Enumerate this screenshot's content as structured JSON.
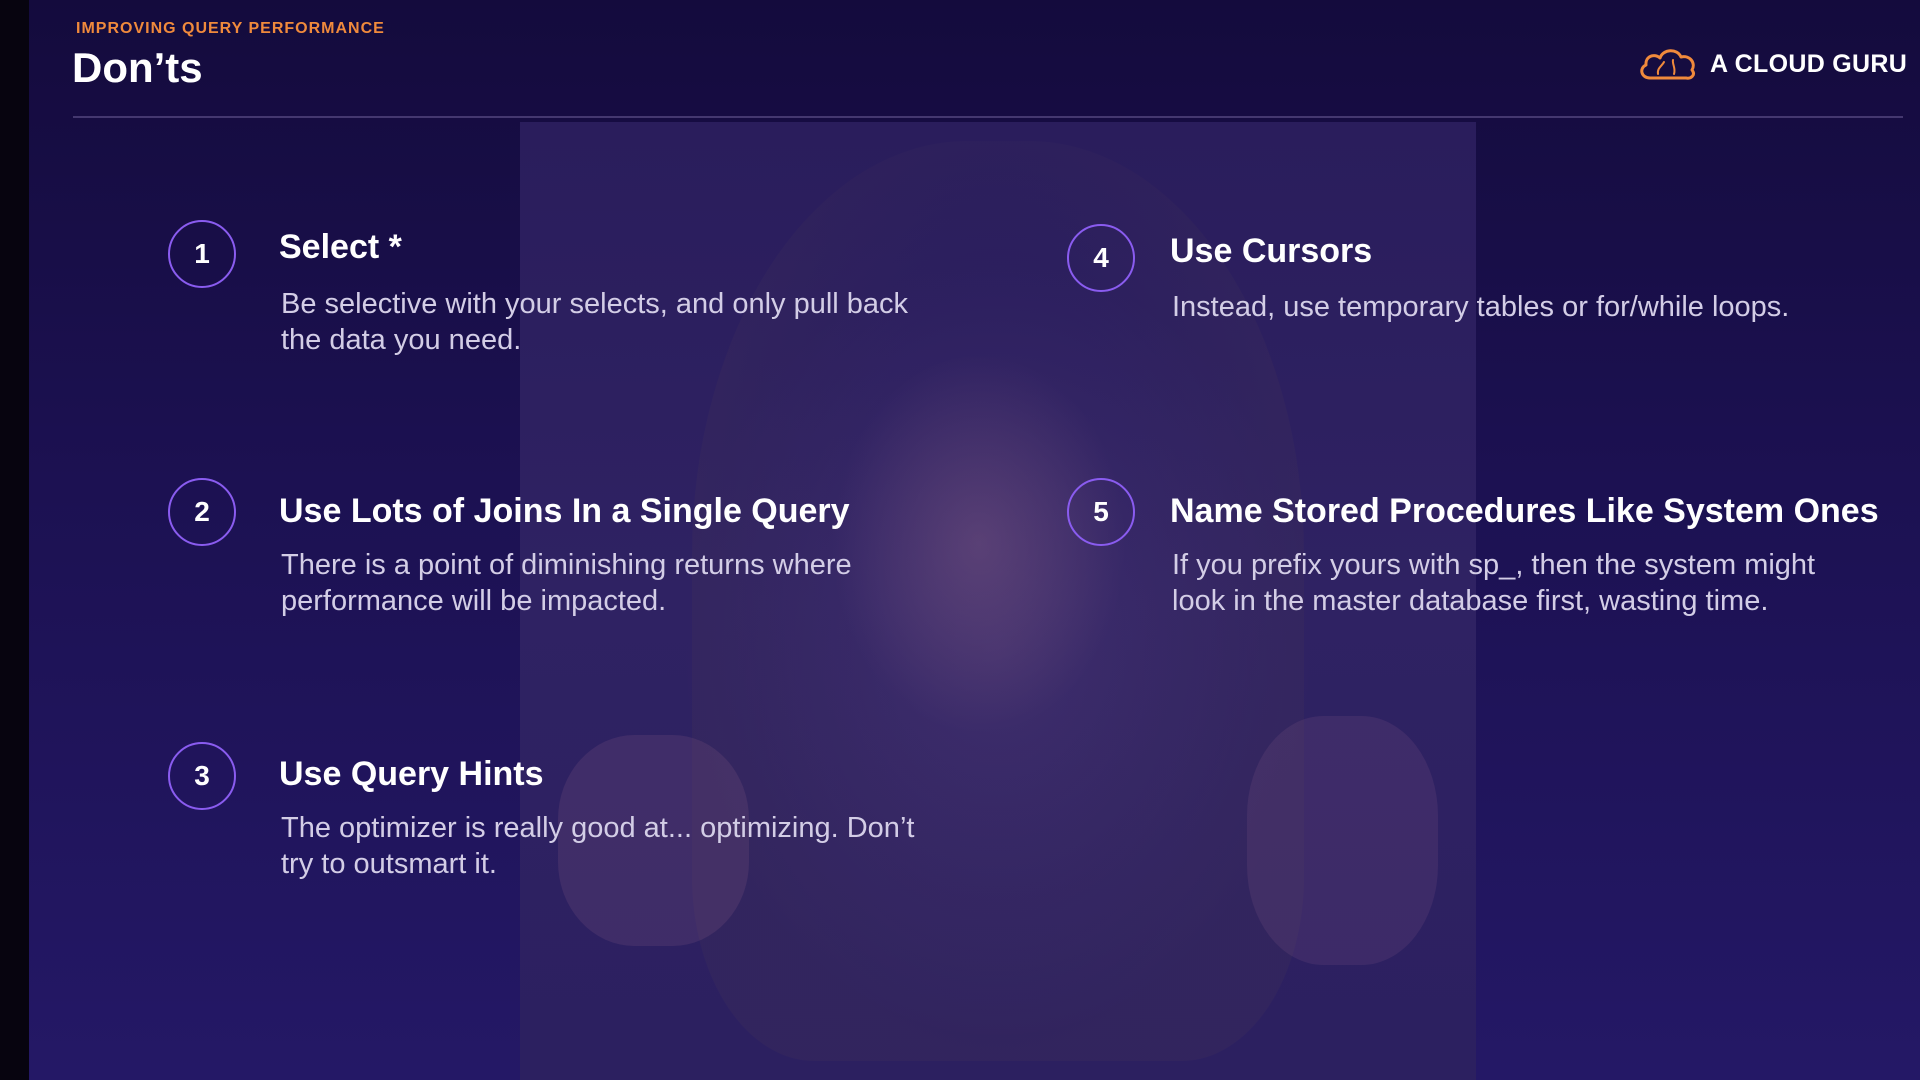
{
  "header": {
    "eyebrow": "IMPROVING QUERY PERFORMANCE",
    "title": "Don’ts"
  },
  "brand": {
    "name": "A CLOUD GURU",
    "icon": "cloud-logo-icon",
    "accent_color": "#f08a3c"
  },
  "colors": {
    "background": "#1c1152",
    "circle_outline": "#8a5cf0",
    "eyebrow": "#f08a3c"
  },
  "items": [
    {
      "number": "1",
      "heading": "Select *",
      "text": "Be selective with your selects, and only pull back the data you need."
    },
    {
      "number": "2",
      "heading": "Use Lots of Joins In a Single Query",
      "text": "There is a point of diminishing returns where performance will be impacted."
    },
    {
      "number": "3",
      "heading": "Use Query Hints",
      "text": "The optimizer is really good at... optimizing. Don’t try to outsmart it."
    },
    {
      "number": "4",
      "heading": "Use Cursors",
      "text": "Instead, use temporary tables or for/while loops."
    },
    {
      "number": "5",
      "heading": "Name Stored Procedures Like System Ones",
      "text": "If you prefix yours with sp_, then the system might look in the master database first, wasting time."
    }
  ]
}
